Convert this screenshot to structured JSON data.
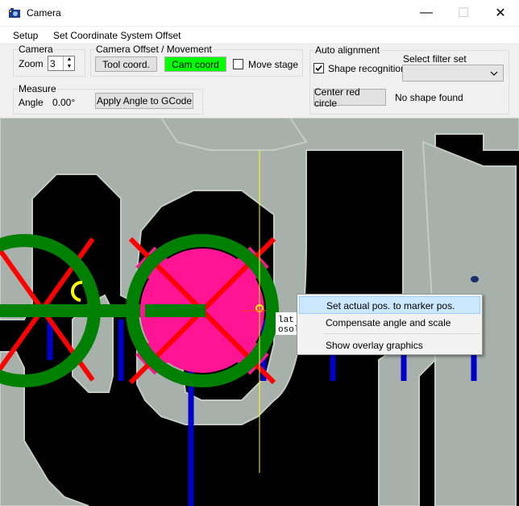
{
  "window": {
    "title": "Camera",
    "icon": "camera-app-icon",
    "minimize": "—",
    "maximize": "☐",
    "close": "✕"
  },
  "menu": {
    "items": [
      "Setup",
      "Set Coordinate System Offset"
    ]
  },
  "camera_group": {
    "label": "Camera",
    "zoom_label": "Zoom",
    "zoom_value": "3"
  },
  "offset_group": {
    "label": "Camera Offset / Movement",
    "tool_button": "Tool coord.",
    "cam_button": "Cam coord",
    "move_stage_label": "Move stage",
    "move_stage_checked": false
  },
  "measure_group": {
    "label": "Measure",
    "angle_label": "Angle",
    "angle_value": "0.00°",
    "apply_button": "Apply Angle to GCode"
  },
  "auto_group": {
    "label": "Auto alignment",
    "shape_label": "Shape recognition",
    "shape_checked": true,
    "filter_label": "Select filter set",
    "filter_value": "",
    "center_button": "Center red circle",
    "status": "No shape found"
  },
  "camera_view": {
    "overlay_text_1": "lat",
    "overlay_text_2": "osol"
  },
  "context_menu": {
    "items": [
      {
        "label": "Set actual pos. to marker pos.",
        "highlighted": true
      },
      {
        "label": "Compensate angle and scale",
        "highlighted": false
      },
      {
        "label": "Show overlay graphics",
        "highlighted": false
      }
    ]
  },
  "colors": {
    "cam_button": "#00ff00",
    "marker_fill": "#ff1493",
    "circle": "#008000",
    "cross": "#ff0000",
    "lines": "#0000cd",
    "crosshair": "#ffff00"
  }
}
